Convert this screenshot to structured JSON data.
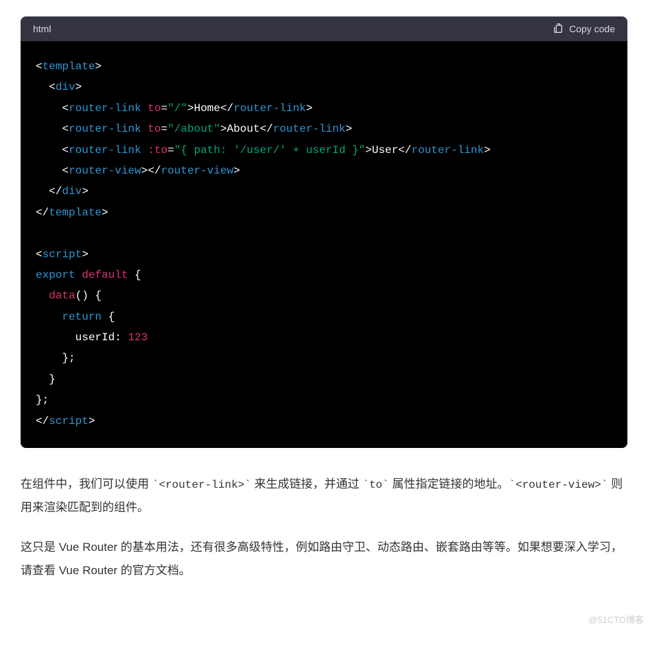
{
  "codeblock": {
    "language": "html",
    "copy_label": "Copy code",
    "lines": [
      [
        [
          "p",
          "<"
        ],
        [
          "t",
          "template"
        ],
        [
          "p",
          ">"
        ]
      ],
      [
        [
          "p",
          "  <"
        ],
        [
          "t",
          "div"
        ],
        [
          "p",
          ">"
        ]
      ],
      [
        [
          "p",
          "    <"
        ],
        [
          "t",
          "router-link"
        ],
        [
          "p",
          " "
        ],
        [
          "a",
          "to"
        ],
        [
          "p",
          "="
        ],
        [
          "s",
          "\"/\""
        ],
        [
          "p",
          ">Home</"
        ],
        [
          "t",
          "router-link"
        ],
        [
          "p",
          ">"
        ]
      ],
      [
        [
          "p",
          "    <"
        ],
        [
          "t",
          "router-link"
        ],
        [
          "p",
          " "
        ],
        [
          "a",
          "to"
        ],
        [
          "p",
          "="
        ],
        [
          "s",
          "\"/about\""
        ],
        [
          "p",
          ">About</"
        ],
        [
          "t",
          "router-link"
        ],
        [
          "p",
          ">"
        ]
      ],
      [
        [
          "p",
          "    <"
        ],
        [
          "t",
          "router-link"
        ],
        [
          "p",
          " "
        ],
        [
          "a",
          ":to"
        ],
        [
          "p",
          "="
        ],
        [
          "s",
          "\"{ path: '/user/' + userId }\""
        ],
        [
          "p",
          ">User</"
        ],
        [
          "t",
          "router-link"
        ],
        [
          "p",
          ">"
        ]
      ],
      [
        [
          "p",
          "    <"
        ],
        [
          "t",
          "router-view"
        ],
        [
          "p",
          "></"
        ],
        [
          "t",
          "router-view"
        ],
        [
          "p",
          ">"
        ]
      ],
      [
        [
          "p",
          "  </"
        ],
        [
          "t",
          "div"
        ],
        [
          "p",
          ">"
        ]
      ],
      [
        [
          "p",
          "</"
        ],
        [
          "t",
          "template"
        ],
        [
          "p",
          ">"
        ]
      ],
      [
        [
          "p",
          ""
        ]
      ],
      [
        [
          "p",
          "<"
        ],
        [
          "t",
          "script"
        ],
        [
          "p",
          ">"
        ]
      ],
      [
        [
          "k",
          "export"
        ],
        [
          "p",
          " "
        ],
        [
          "kr",
          "default"
        ],
        [
          "p",
          " {"
        ]
      ],
      [
        [
          "p",
          "  "
        ],
        [
          "a",
          "data"
        ],
        [
          "p",
          "() {"
        ]
      ],
      [
        [
          "p",
          "    "
        ],
        [
          "k",
          "return"
        ],
        [
          "p",
          " {"
        ]
      ],
      [
        [
          "p",
          "      userId: "
        ],
        [
          "n",
          "123"
        ]
      ],
      [
        [
          "p",
          "    };"
        ]
      ],
      [
        [
          "p",
          "  }"
        ]
      ],
      [
        [
          "p",
          "};"
        ]
      ],
      [
        [
          "p",
          "</"
        ],
        [
          "t",
          "script"
        ],
        [
          "p",
          ">"
        ]
      ]
    ]
  },
  "prose": {
    "p1_parts": [
      {
        "type": "text",
        "val": "在组件中，我们可以使用 "
      },
      {
        "type": "code",
        "val": "`<router-link>`"
      },
      {
        "type": "text",
        "val": " 来生成链接，并通过 "
      },
      {
        "type": "code",
        "val": "`to`"
      },
      {
        "type": "text",
        "val": " 属性指定链接的地址。"
      },
      {
        "type": "code",
        "val": "`<router-view>`"
      },
      {
        "type": "text",
        "val": " 则用来渲染匹配到的组件。"
      }
    ],
    "p2": "这只是 Vue Router 的基本用法，还有很多高级特性，例如路由守卫、动态路由、嵌套路由等等。如果想要深入学习，请查看 Vue Router 的官方文档。"
  },
  "watermark": "@51CTO博客"
}
